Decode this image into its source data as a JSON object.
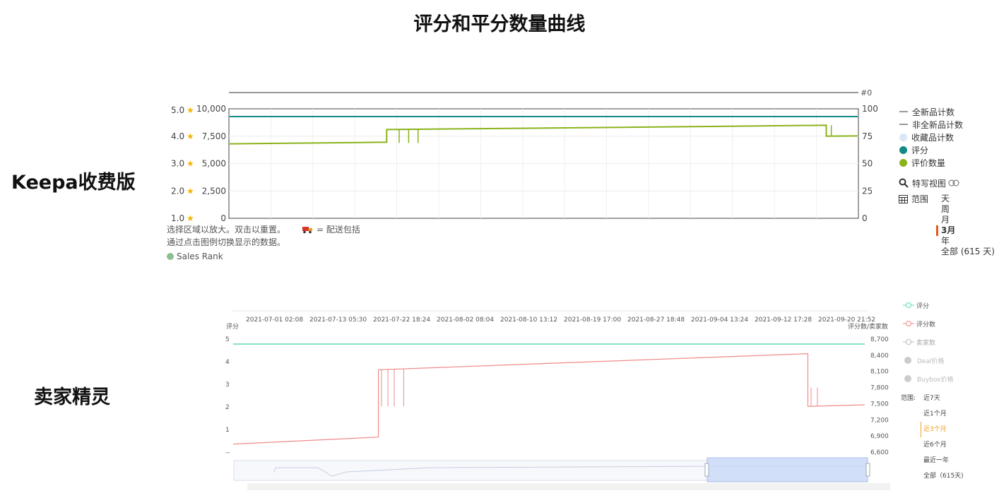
{
  "page": {
    "title": "评分和平分数量曲线",
    "keepa_label": "Keepa收费版",
    "seller_label": "卖家精灵"
  },
  "keepa": {
    "notes": [
      "选择区域以放大。双击以重置。",
      "通过点击图例切换显示的数据。"
    ],
    "shipping_note": "= 配送包括",
    "sales_rank_label": "Sales Rank",
    "top_axis_label": "#0",
    "legend": [
      {
        "label": "全新品计数",
        "style": "dash",
        "color": "#999999"
      },
      {
        "label": "非全新品计数",
        "style": "dash",
        "color": "#999999"
      },
      {
        "label": "收藏品计数",
        "style": "dot",
        "color": "#dbe6f7"
      },
      {
        "label": "评分",
        "style": "dot",
        "color": "#138a86"
      },
      {
        "label": "评价数量",
        "style": "dot",
        "color": "#8ab31a"
      }
    ],
    "zoom_label": "特写视图",
    "range_label": "范围",
    "range_options": [
      "天",
      "周",
      "月",
      "3月",
      "年",
      "全部 (615 天)"
    ],
    "range_active": "3月",
    "colors": {
      "rating": "#138a86",
      "reviews": "#8ab31a",
      "star": "#f3b500"
    }
  },
  "seller": {
    "legend": [
      {
        "label": "评分",
        "color": "#5fd9b2",
        "muted": false
      },
      {
        "label": "评分数",
        "color": "#f08a8a",
        "muted": false
      },
      {
        "label": "卖家数",
        "color": "#bbbbbb",
        "muted": true
      },
      {
        "label": "Deal价格",
        "color": "#cccccc",
        "muted": true
      },
      {
        "label": "Buybox价格",
        "color": "#cccccc",
        "muted": true
      }
    ],
    "range_label": "范围:",
    "range_options": [
      "近7天",
      "近1个月",
      "近3个月",
      "近6个月",
      "最近一年",
      "全部（615天)"
    ],
    "range_active": "近3个月",
    "left_axis_title": "评分",
    "right_axis_title": "评分数/卖家数",
    "colors": {
      "rating": "#5fd9b2",
      "reviews": "#f08a8a"
    }
  },
  "chart_data": [
    {
      "type": "line",
      "source": "Keepa",
      "y_left_rating_ticks": [
        "5.0",
        "4.0",
        "3.0",
        "2.0",
        "1.0"
      ],
      "y_left_count_ticks": [
        "10,000",
        "7,500",
        "5,000",
        "2,500",
        "0"
      ],
      "y_right_ticks": [
        "100",
        "75",
        "50",
        "25",
        "0"
      ],
      "ylim_count": [
        0,
        10000
      ],
      "grid": true,
      "series": [
        {
          "name": "评分",
          "values_desc": "constant",
          "x": [
            0,
            1
          ],
          "y": [
            4.8,
            4.8
          ]
        },
        {
          "name": "评价数量",
          "x": [
            0,
            0.25,
            0.25,
            0.52,
            0.95,
            0.95,
            1
          ],
          "y": [
            6800,
            6950,
            8100,
            8250,
            8500,
            7500,
            7520
          ]
        }
      ]
    },
    {
      "type": "line",
      "source": "卖家精灵",
      "x_ticks": [
        "2021-07-01 02:08",
        "2021-07-13 05:30",
        "2021-07-22 18:24",
        "2021-08-02 08:04",
        "2021-08-10 13:12",
        "2021-08-19 17:00",
        "2021-08-27 18:48",
        "2021-09-04 13:24",
        "2021-09-12 17:28",
        "2021-09-20 21:52"
      ],
      "y_left_ticks": [
        "5",
        "4",
        "3",
        "2",
        "1",
        "--"
      ],
      "y_right_ticks": [
        "8,700",
        "8,400",
        "8,100",
        "7,800",
        "7,500",
        "7,200",
        "6,900",
        "6,600"
      ],
      "ylim_right": [
        6600,
        8700
      ],
      "series": [
        {
          "name": "评分",
          "x": [
            0,
            1
          ],
          "y": [
            4.8,
            4.8
          ]
        },
        {
          "name": "评分数",
          "x": [
            0,
            0.23,
            0.23,
            0.91,
            0.91,
            1
          ],
          "y": [
            6750,
            6880,
            8130,
            8430,
            7450,
            7480
          ]
        }
      ]
    }
  ]
}
